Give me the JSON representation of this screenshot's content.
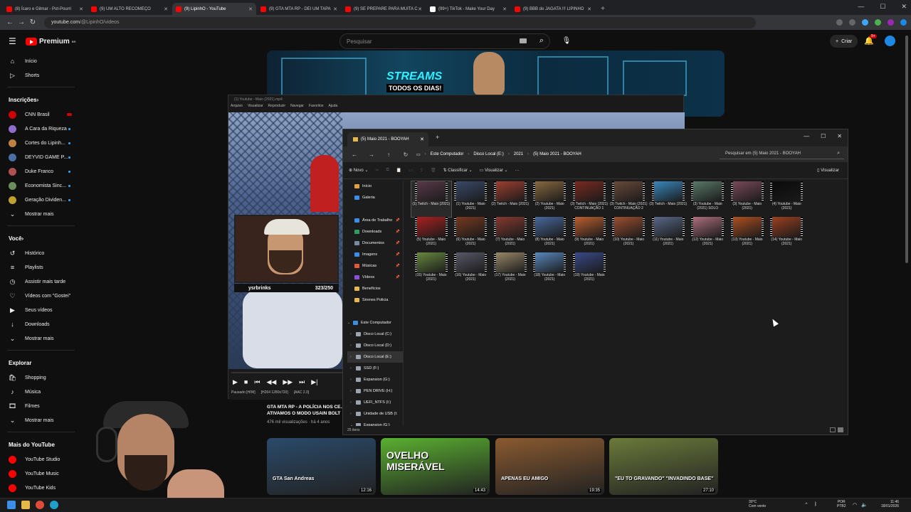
{
  "browser": {
    "tabs": [
      {
        "label": "(8) Ícaro e Gilmar - Pot-Pourri",
        "color": "#ff0000"
      },
      {
        "label": "(9) UM ALTO RECOMEÇO",
        "color": "#ff0000"
      },
      {
        "label": "(9) LipinhO - YouTube",
        "color": "#ff0000",
        "active": true
      },
      {
        "label": "(9) GTA MTA RP - DEI UM TAPA",
        "color": "#ff0000"
      },
      {
        "label": "(9) SE PREPARE PARA MUITA C",
        "color": "#ff0000"
      },
      {
        "label": "(99+) TikTok - Make Your Day",
        "color": "#ffffff"
      },
      {
        "label": "(9) BBB do JAGATA !!! LIPINHO",
        "color": "#ff0000"
      }
    ],
    "url_host": "youtube.com",
    "url_path": "/@LipinhO/videos"
  },
  "youtube": {
    "logo_text": "Premium",
    "logo_sup": "BR",
    "search_placeholder": "Pesquisar",
    "create_label": "Criar",
    "notif_count": "9+"
  },
  "sidebar": {
    "main": [
      {
        "label": "Início",
        "icon": "home-icon"
      },
      {
        "label": "Shorts",
        "icon": "shorts-icon"
      }
    ],
    "subs_title": "Inscrições",
    "subs": [
      {
        "label": "CNN Brasil",
        "color": "#cc0000",
        "live": true
      },
      {
        "label": "A Cara da Riqueza",
        "color": "#8e6cc9",
        "dot": true
      },
      {
        "label": "Cortes do Lipinh...",
        "color": "#c08040",
        "dot": true
      },
      {
        "label": "DEYVID GAME P...",
        "color": "#4a6fa5",
        "dot": true
      },
      {
        "label": "Duke Franco",
        "color": "#b05050",
        "dot": true
      },
      {
        "label": "Economista Sinc...",
        "color": "#6b8e5a",
        "dot": true
      },
      {
        "label": "Geração Dividen...",
        "color": "#c0a030",
        "dot": true
      }
    ],
    "subs_more": "Mostrar mais",
    "you_title": "Você",
    "you": [
      {
        "label": "Histórico",
        "icon": "history-icon"
      },
      {
        "label": "Playlists",
        "icon": "playlists-icon"
      },
      {
        "label": "Assistir mais tarde",
        "icon": "watch-later-icon"
      },
      {
        "label": "Vídeos com \"Gostei\"",
        "icon": "like-icon"
      },
      {
        "label": "Seus vídeos",
        "icon": "your-videos-icon"
      },
      {
        "label": "Downloads",
        "icon": "download-icon"
      }
    ],
    "you_more": "Mostrar mais",
    "explore_title": "Explorar",
    "explore": [
      {
        "label": "Shopping",
        "icon": "shopping-icon"
      },
      {
        "label": "Música",
        "icon": "music-icon"
      },
      {
        "label": "Filmes",
        "icon": "film-icon"
      }
    ],
    "explore_more": "Mostrar mais",
    "more_title": "Mais do YouTube",
    "more": [
      {
        "label": "YouTube Studio",
        "color": "#ff0000"
      },
      {
        "label": "YouTube Music",
        "color": "#ff0000"
      },
      {
        "label": "YouTube Kids",
        "color": "#ff0000"
      }
    ]
  },
  "banner": {
    "headline": "STREAMS",
    "subline": "TODOS OS DIAS!"
  },
  "player": {
    "title": "(1) Youtube - Maio (2021).mp4",
    "menu": [
      "Arquivo",
      "Visualizar",
      "Reproduzir",
      "Navegar",
      "Favoritos",
      "Ajuda"
    ],
    "webcam_name": "ysrbrinks",
    "webcam_count": "323/250",
    "status": [
      "Pausado [H/W]",
      "[H264 1280x720]",
      "[AAC 2.0]"
    ]
  },
  "explorer": {
    "tab_title": "(5) Maio 2021 - BOOYAH",
    "path": [
      "Este Computador",
      "Disco Local (E:)",
      "2021",
      "(5) Maio 2021 - BOOYAH"
    ],
    "search_placeholder": "Pesquisar em (5) Maio 2021 - BOOYAH",
    "cmd_new": "Novo",
    "cmd_sort": "Classificar",
    "cmd_view": "Visualizar",
    "cmd_more": "···",
    "cmd_details": "Visualizar",
    "nav_top": [
      {
        "label": "Início",
        "color": "#e0a040"
      },
      {
        "label": "Galeria",
        "color": "#3a8ee6"
      }
    ],
    "nav_quick": [
      {
        "label": "Área de Trabalho",
        "color": "#3a8ee6",
        "pin": true
      },
      {
        "label": "Downloads",
        "color": "#2e9b5f",
        "pin": true
      },
      {
        "label": "Documentos",
        "color": "#7a8aa0",
        "pin": true
      },
      {
        "label": "Imagens",
        "color": "#3a8ee6",
        "pin": true
      },
      {
        "label": "Músicas",
        "color": "#e05a3a",
        "pin": true
      },
      {
        "label": "Vídeos",
        "color": "#8e4fd8",
        "pin": true
      },
      {
        "label": "Benefícios",
        "color": "#e6b84a",
        "pin": false
      },
      {
        "label": "Sirenes Policia",
        "color": "#e6b84a",
        "pin": false
      }
    ],
    "nav_pc": [
      {
        "label": "Este Computador",
        "expanded": true,
        "color": "#3a8ee6"
      },
      {
        "label": "Disco Local (C:)",
        "color": "#9aa5b1"
      },
      {
        "label": "Disco Local (D:)",
        "color": "#9aa5b1"
      },
      {
        "label": "Disco Local (E:)",
        "color": "#9aa5b1",
        "selected": true
      },
      {
        "label": "SSD (F:)",
        "color": "#9aa5b1"
      },
      {
        "label": "Expansion (G:)",
        "color": "#9aa5b1"
      },
      {
        "label": "PEN DRIVE (H:)",
        "color": "#9aa5b1"
      },
      {
        "label": "UEFI_NTFS (I:)",
        "color": "#9aa5b1"
      },
      {
        "label": "Unidade de USB (I:",
        "color": "#9aa5b1"
      },
      {
        "label": "Expansion (G:)",
        "expanded": true,
        "color": "#9aa5b1"
      }
    ],
    "files": [
      {
        "label": "(1) Twitch - Maio (2021)",
        "color": "#5a3a4a",
        "selected": true
      },
      {
        "label": "(1) Youtube - Maio (2021)",
        "color": "#3a4a6a"
      },
      {
        "label": "(2) Twitch - Maio (2021)",
        "color": "#a04030"
      },
      {
        "label": "(2) Youtube - Maio (2021)",
        "color": "#8a6a40"
      },
      {
        "label": "(3) Twitch - Maio (2021) CONTINUAÇÃO 1",
        "color": "#7a2a20"
      },
      {
        "label": "(3) Twitch - Maio (2021) CONTINUAÇÃO 2",
        "color": "#6a4a3a"
      },
      {
        "label": "(3) Twitch - Maio (2021)",
        "color": "#3a8ac0"
      },
      {
        "label": "(3) Youtube - Maio (2021) SOLO",
        "color": "#5a7a6a"
      },
      {
        "label": "(3) Youtube - Maio (2021)",
        "color": "#7a4a5a"
      },
      {
        "label": "(4) Youtube - Maio (2021)",
        "color": "#0a0a0a"
      },
      {
        "label": "(5) Youtube - Maio (2021)",
        "color": "#b02020"
      },
      {
        "label": "(6) Youtube - Maio (2021)",
        "color": "#7a3a20"
      },
      {
        "label": "(7) Youtube - Maio (2021)",
        "color": "#8a3a30"
      },
      {
        "label": "(8) Youtube - Maio (2021)",
        "color": "#4a6aa0"
      },
      {
        "label": "(9) Youtube - Maio (2021)",
        "color": "#c06030"
      },
      {
        "label": "(10) Youtube - Maio (2021)",
        "color": "#a05030"
      },
      {
        "label": "(11) Youtube - Maio (2021)",
        "color": "#5a6a8a"
      },
      {
        "label": "(12) Youtube - Maio (2021)",
        "color": "#b07080"
      },
      {
        "label": "(13) Youtube - Maio (2021)",
        "color": "#b05020"
      },
      {
        "label": "(14) Youtube - Maio (2021)",
        "color": "#a04020"
      },
      {
        "label": "(15) Youtube - Maio (2021)",
        "color": "#6a8a40"
      },
      {
        "label": "(16) Youtube - Maio (2021)",
        "color": "#5a5a6a"
      },
      {
        "label": "(17) Youtube - Maio (2021)",
        "color": "#9a8a6a"
      },
      {
        "label": "(18) Youtube - Maio (2021)",
        "color": "#5a8ac0"
      },
      {
        "label": "(19) Youtube - Maio (2021)",
        "color": "#3a4a8a"
      }
    ],
    "status": "25 itens"
  },
  "videos": {
    "current_title": "GTA MTA RP - A POLÍCIA NOS CE... ATIVAMOS O MODO USAIN BOLT",
    "current_meta": "476 mil visualizações · há 4 anos",
    "thumbs": [
      {
        "duration": "12:16",
        "caption": "GTA San Andreas",
        "color": "#2a4a6a"
      },
      {
        "duration": "14:43",
        "caption": "OVELHO MISERÁVEL",
        "color": "#5ab030"
      },
      {
        "duration": "19:35",
        "caption": "APENAS EU AMIGO",
        "color": "#8a5a30"
      },
      {
        "duration": "27:10",
        "caption": "\"EU TO GRAVANDO\" \"INVADINDO BASE\"",
        "color": "#6a7a3a"
      }
    ]
  },
  "taskbar": {
    "weather_temp": "30°C",
    "weather_desc": "Com vento",
    "lang1": "POR",
    "lang2": "PTB2",
    "time": "11:46",
    "date": "18/01/2026"
  }
}
